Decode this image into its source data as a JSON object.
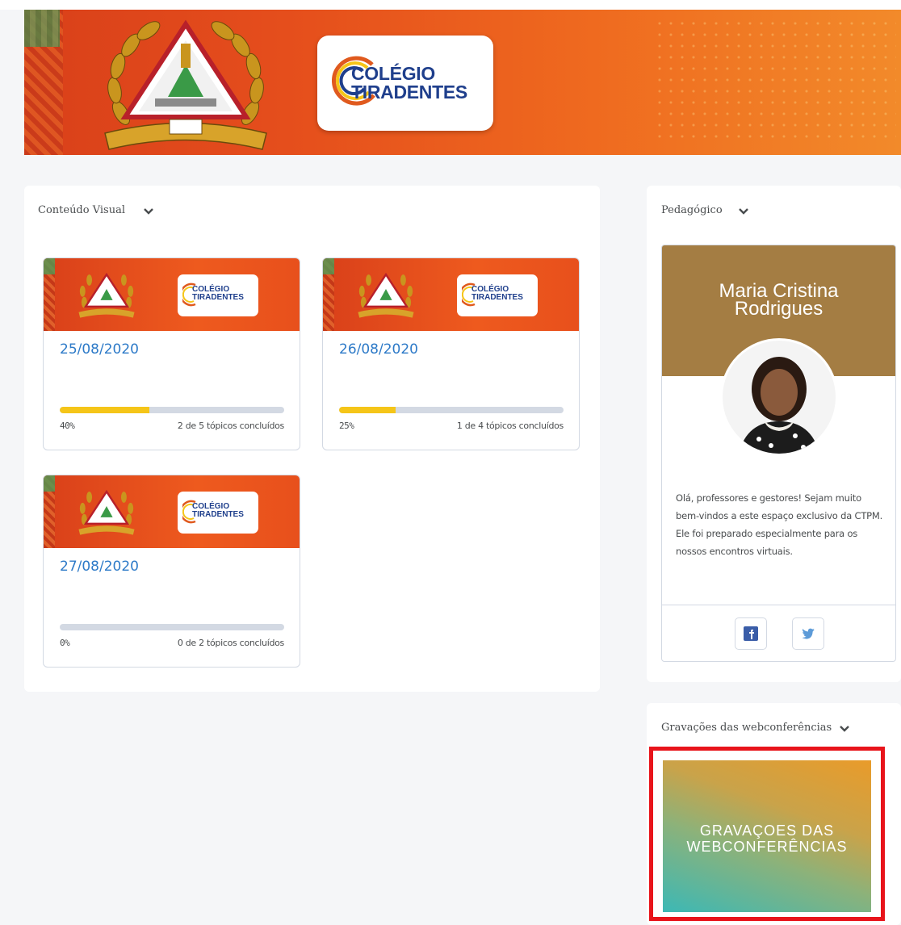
{
  "banner": {
    "logo_line1": "COLÉGIO",
    "logo_line2": "TIRADENTES",
    "emblem_icon": "police-coat-of-arms-icon"
  },
  "visual_panel": {
    "title": "Conteúdo Visual",
    "cards": [
      {
        "date": "25/08/2020",
        "percent": "40%",
        "progress": 0.4,
        "topics": "2 de 5 tópicos concluídos"
      },
      {
        "date": "26/08/2020",
        "percent": "25%",
        "progress": 0.25,
        "topics": "1 de 4 tópicos concluídos"
      },
      {
        "date": "27/08/2020",
        "percent": "0%",
        "progress": 0,
        "topics": "0 de 2 tópicos concluídos"
      }
    ],
    "card_logo_line1": "COLÉGIO",
    "card_logo_line2": "TIRADENTES"
  },
  "pedagogico": {
    "title": "Pedagógico",
    "name_line1": "Maria Cristina",
    "name_line2": "Rodrigues",
    "intro": "Olá, professores e gestores! Sejam muito bem-vindos a este espaço exclusivo da CTPM. Ele foi preparado especialmente para os nossos encontros virtuais.",
    "social": [
      "facebook-icon",
      "twitter-icon"
    ]
  },
  "gravacoes": {
    "title": "Gravações das webconferências",
    "image_line1": "GRAVAÇOES DAS",
    "image_line2": "WEBCONFERÊNCIAS"
  },
  "colors": {
    "banner_orange": "#e54e1c",
    "link_blue": "#2d7ac8",
    "progress_yellow": "#f5c518",
    "profile_brown": "#a47d43",
    "highlight_red": "#e8141b"
  }
}
